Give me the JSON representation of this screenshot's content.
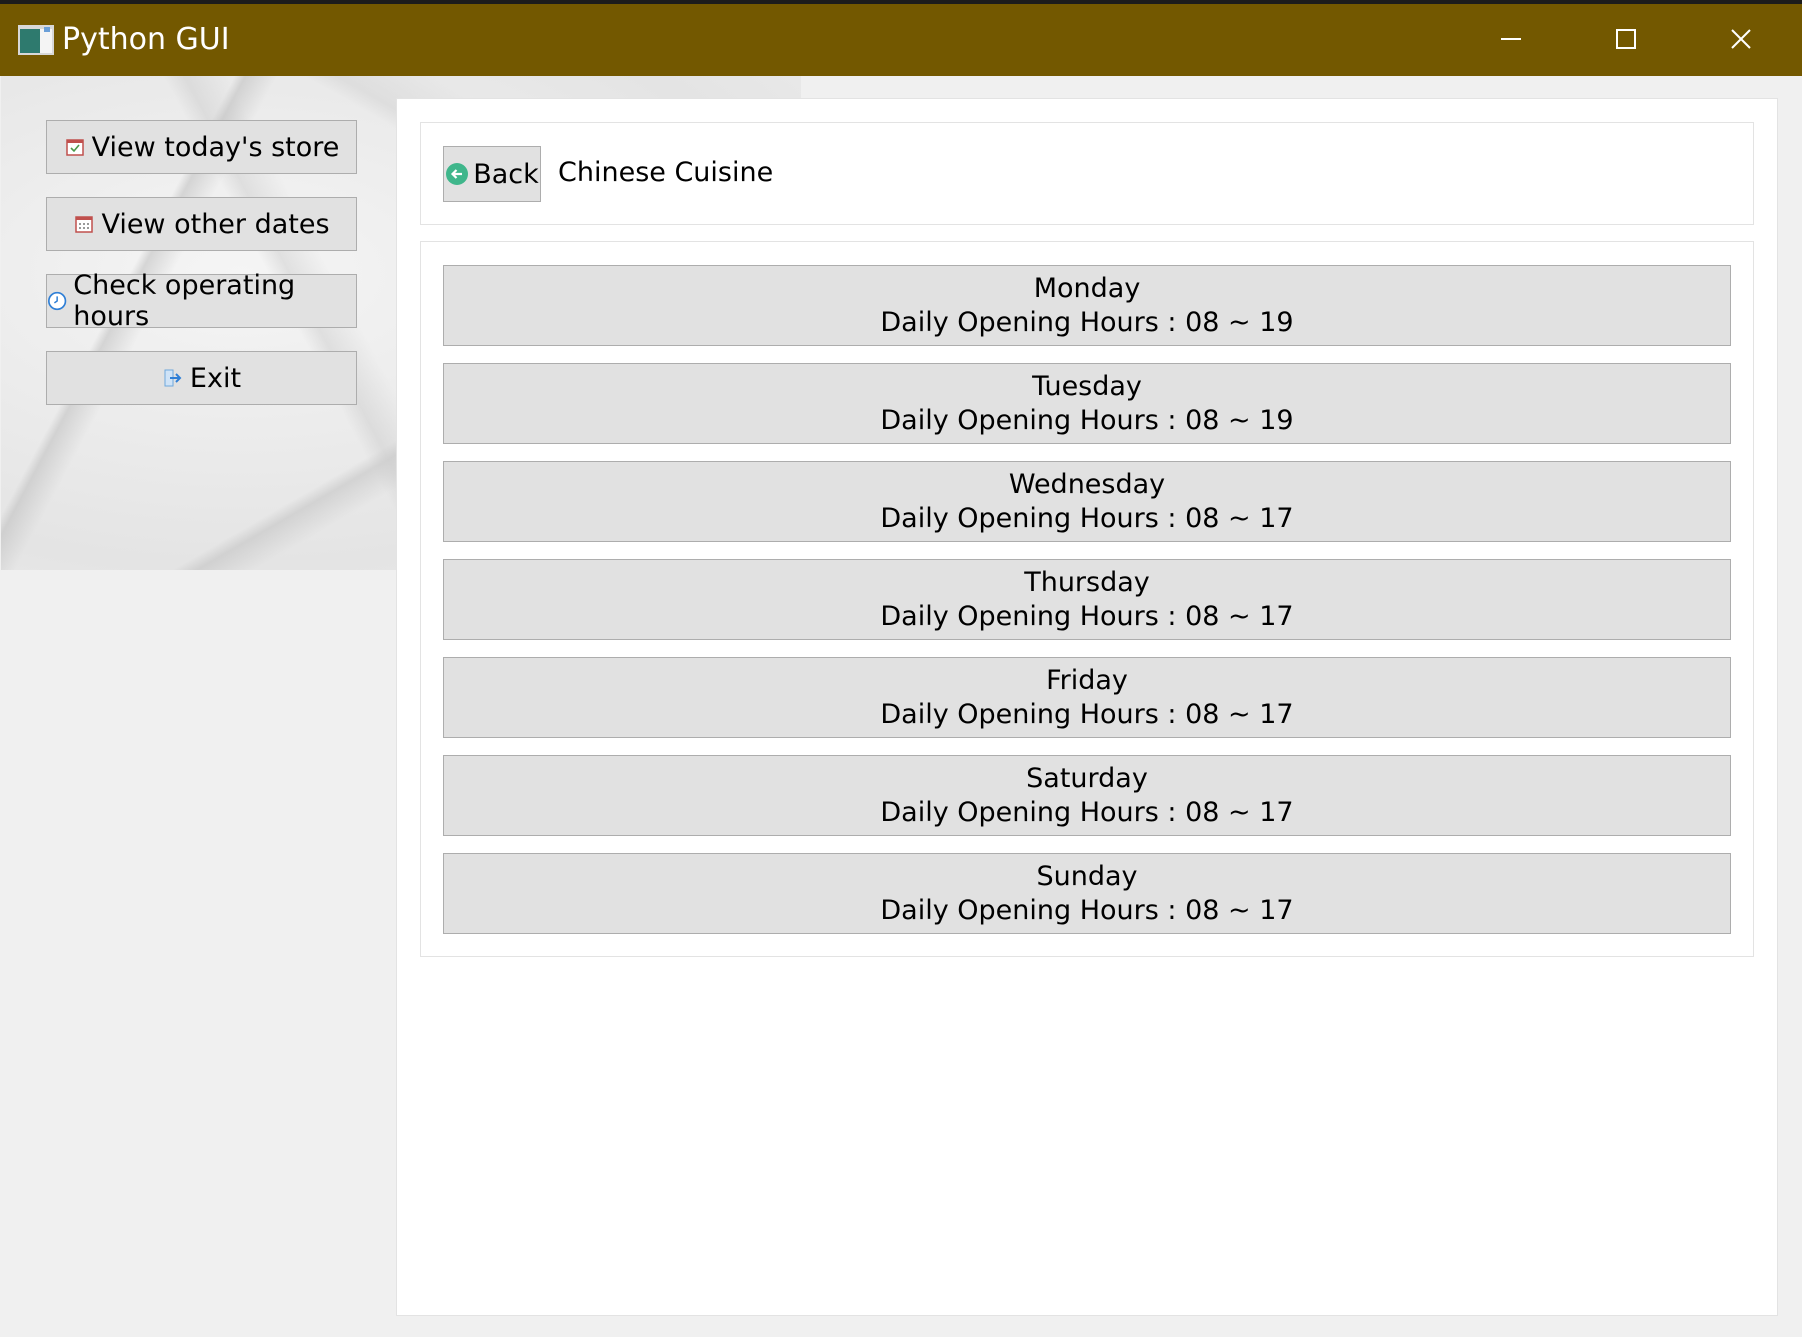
{
  "window": {
    "title": "Python GUI",
    "controls": {
      "minimize": "minimize-icon",
      "maximize": "maximize-icon",
      "close": "close-icon"
    }
  },
  "sidebar": {
    "items": [
      {
        "label": "View today's store",
        "icon": "calendar-check-icon"
      },
      {
        "label": "View other dates",
        "icon": "calendar-icon"
      },
      {
        "label": "Check operating hours",
        "icon": "clock-icon"
      },
      {
        "label": "Exit",
        "icon": "exit-arrow-icon"
      }
    ]
  },
  "header": {
    "back_label": "Back",
    "store_name": "Chinese Cuisine"
  },
  "hours_label": "Daily Opening Hours : ",
  "days": [
    {
      "day": "Monday",
      "hours": "Daily Opening Hours : 08 ~ 19"
    },
    {
      "day": "Tuesday",
      "hours": "Daily Opening Hours : 08 ~ 19"
    },
    {
      "day": "Wednesday",
      "hours": "Daily Opening Hours : 08 ~ 17"
    },
    {
      "day": "Thursday",
      "hours": "Daily Opening Hours : 08 ~ 17"
    },
    {
      "day": "Friday",
      "hours": "Daily Opening Hours : 08 ~ 17"
    },
    {
      "day": "Saturday",
      "hours": "Daily Opening Hours : 08 ~ 17"
    },
    {
      "day": "Sunday",
      "hours": "Daily Opening Hours : 08 ~ 17"
    }
  ],
  "colors": {
    "titlebar": "#735800",
    "button_face": "#e1e1e1",
    "button_border": "#adadad",
    "back_icon": "#3fb68b",
    "clock_icon": "#2f7fd6"
  }
}
